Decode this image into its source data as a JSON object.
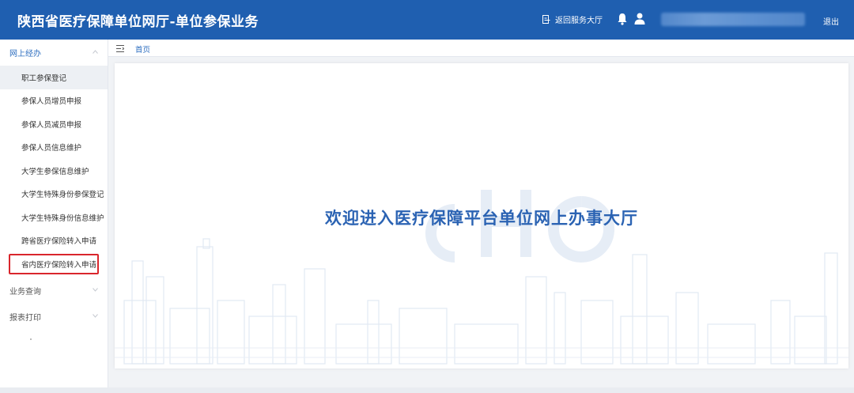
{
  "header": {
    "title": "陕西省医疗保障单位网厅-单位参保业务",
    "return_label": "返回服务大厅",
    "logout_label": "退出",
    "bg_color": "#1f5fb0"
  },
  "sidebar": {
    "groups": [
      {
        "label": "网上经办",
        "expanded": true,
        "items": [
          {
            "label": "职工参保登记",
            "active": true
          },
          {
            "label": "参保人员增员申报"
          },
          {
            "label": "参保人员减员申报"
          },
          {
            "label": "参保人员信息维护"
          },
          {
            "label": "大学生参保信息维护"
          },
          {
            "label": "大学生特殊身份参保登记"
          },
          {
            "label": "大学生特殊身份信息维护"
          },
          {
            "label": "跨省医疗保险转入申请"
          },
          {
            "label": "省内医疗保险转入申请",
            "highlighted": true,
            "highlight_color": "#d9262c"
          }
        ]
      },
      {
        "label": "业务查询",
        "expanded": false
      },
      {
        "label": "报表打印",
        "expanded": false
      }
    ]
  },
  "breadcrumb": {
    "home_label": "首页"
  },
  "main": {
    "welcome_text": "欢迎进入医疗保障平台单位网上办事大厅",
    "accent_color": "#2b63b3"
  },
  "icons": [
    "document-return-icon",
    "bell-icon",
    "user-icon",
    "chevron-down-icon",
    "menu-toggle-icon"
  ]
}
